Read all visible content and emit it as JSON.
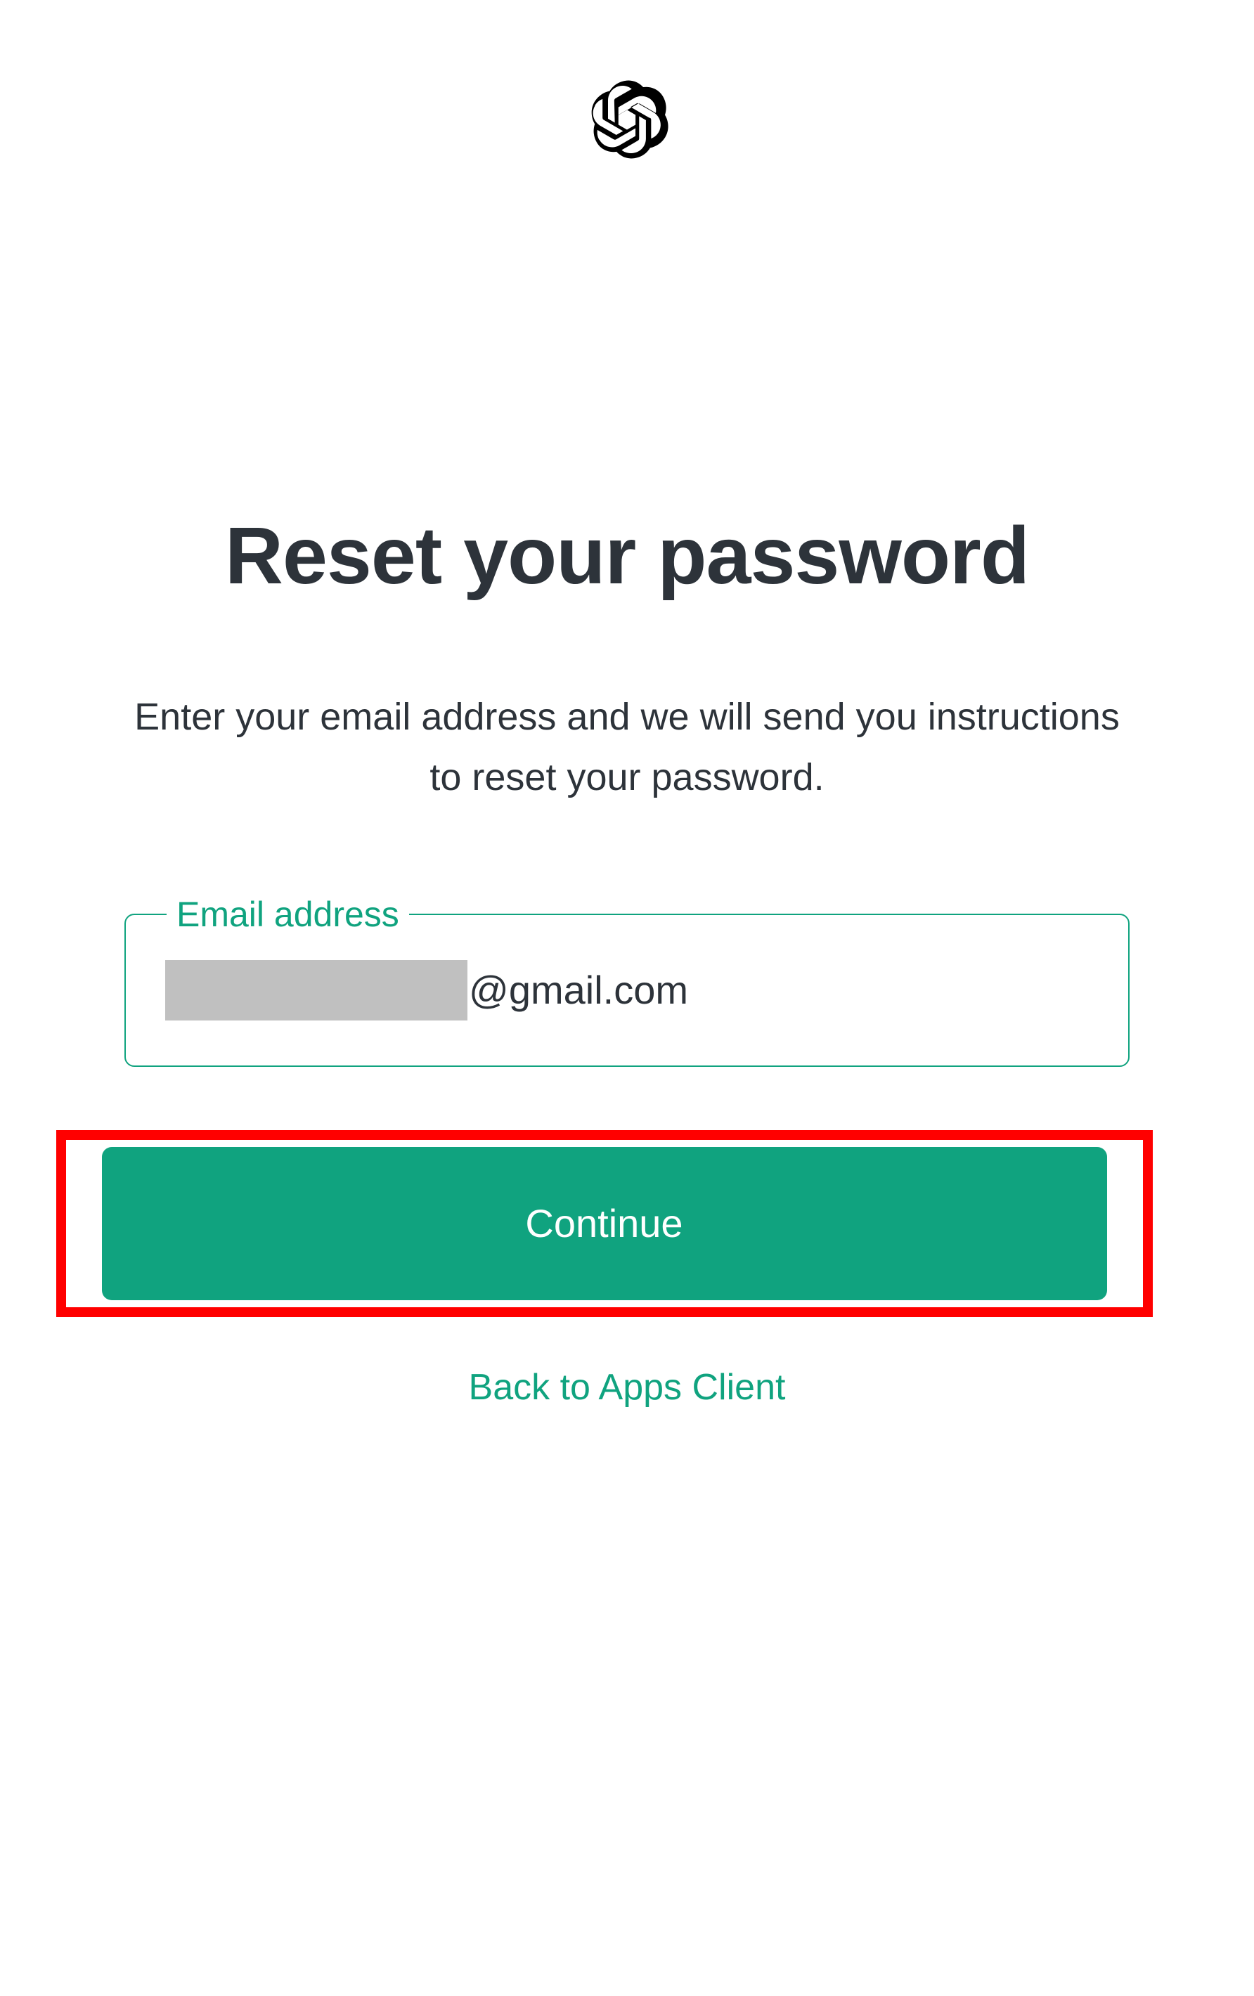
{
  "page": {
    "heading": "Reset your password",
    "subtext": "Enter your email address and we will send you instructions to reset your password."
  },
  "form": {
    "email_label": "Email address",
    "email_suffix": "@gmail.com",
    "continue_label": "Continue"
  },
  "links": {
    "back_label": "Back to Apps Client"
  },
  "colors": {
    "accent": "#10a37f",
    "text": "#2d333a",
    "highlight": "#ff0000"
  }
}
